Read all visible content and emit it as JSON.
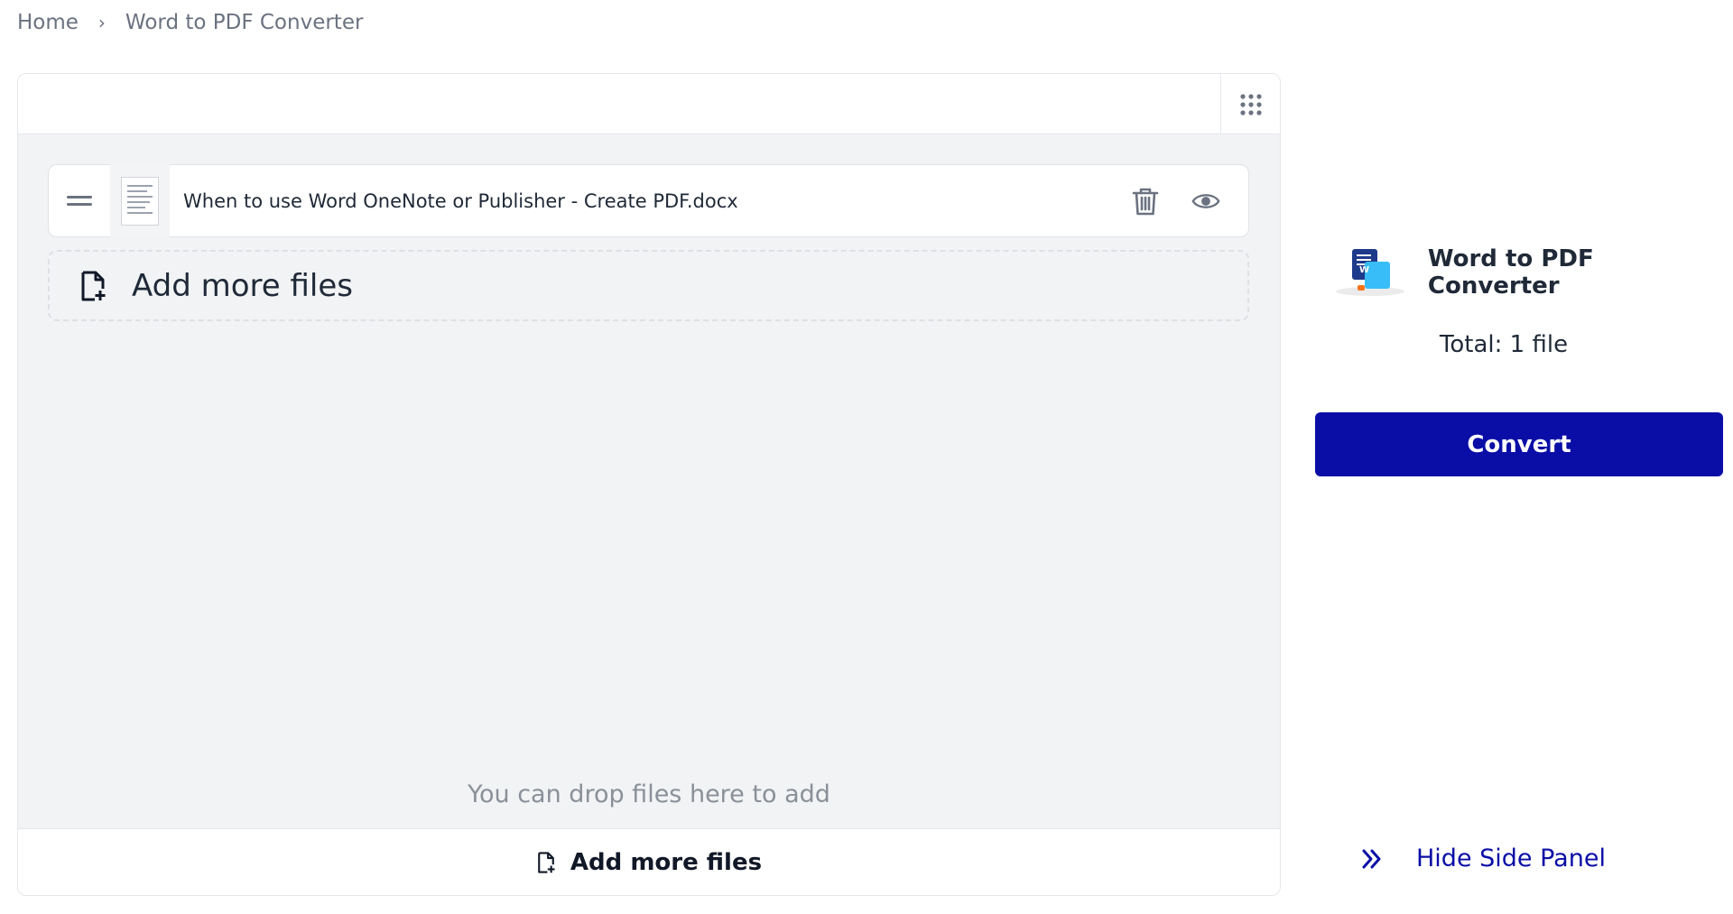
{
  "breadcrumb": {
    "home": "Home",
    "separator": "›",
    "current": "Word to PDF Converter"
  },
  "toolbar": {
    "grid_icon": "grid-icon"
  },
  "files": [
    {
      "name": "When to use Word OneNote or Publisher - Create PDF.docx"
    }
  ],
  "add_more_dashed": {
    "label": "Add more files",
    "icon": "file-add-icon"
  },
  "drop_hint": "You can drop files here to add",
  "footer": {
    "label": "Add more files",
    "icon": "file-add-icon"
  },
  "side_panel": {
    "tool_title": "Word to PDF Converter",
    "total": "Total: 1 file",
    "convert_label": "Convert",
    "hide_label": "Hide Side Panel",
    "hide_icon": "chevron-double-right-icon"
  },
  "colors": {
    "primary": "#0a0ea6",
    "panel_bg": "#f1f3f5",
    "border": "#e5e7eb",
    "muted_text": "#6b7280"
  }
}
